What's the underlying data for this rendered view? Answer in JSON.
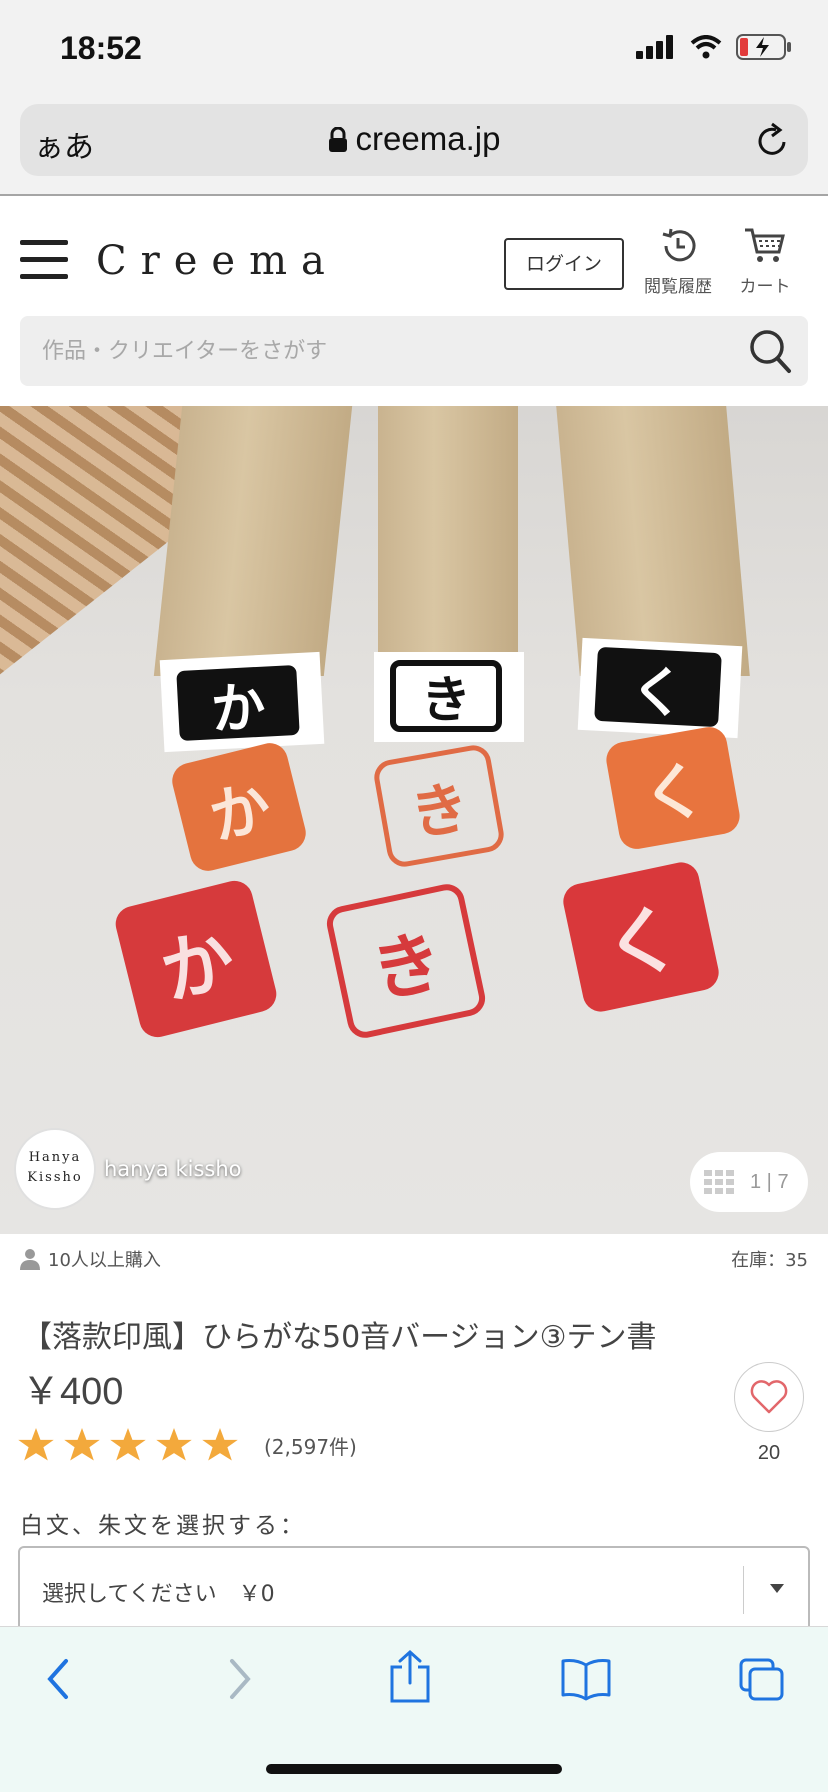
{
  "status_bar": {
    "time": "18:52"
  },
  "browser": {
    "text_size_label": "ぁあ",
    "host": "creema.jp"
  },
  "header": {
    "logo": "Creema",
    "login_label": "ログイン",
    "history_label": "閲覧履歴",
    "cart_label": "カート"
  },
  "search": {
    "placeholder": "作品・クリエイターをさがす"
  },
  "gallery": {
    "shop_avatar_line1": "Hanya",
    "shop_avatar_line2": "Kissho",
    "shop_name": "hanya kissho",
    "image_counter_current": "1",
    "image_counter_total": "7",
    "stamp_kana": [
      "か",
      "き",
      "く"
    ]
  },
  "product": {
    "buyers": "10人以上購入",
    "stock": "在庫：35",
    "title": "【落款印風】ひらがな50音バージョン③テン書",
    "price": "￥400",
    "rating_stars": 5,
    "review_count": "(2,597件)",
    "favorite_count": "20"
  },
  "options": {
    "label": "白文、朱文を選択する：",
    "selected": "選択してください　￥0"
  },
  "colors": {
    "star": "#f3a93c",
    "heart": "#e2676b",
    "toolbar_icon": "#1f74e0",
    "toolbar_disabled": "#a9b9c4"
  }
}
